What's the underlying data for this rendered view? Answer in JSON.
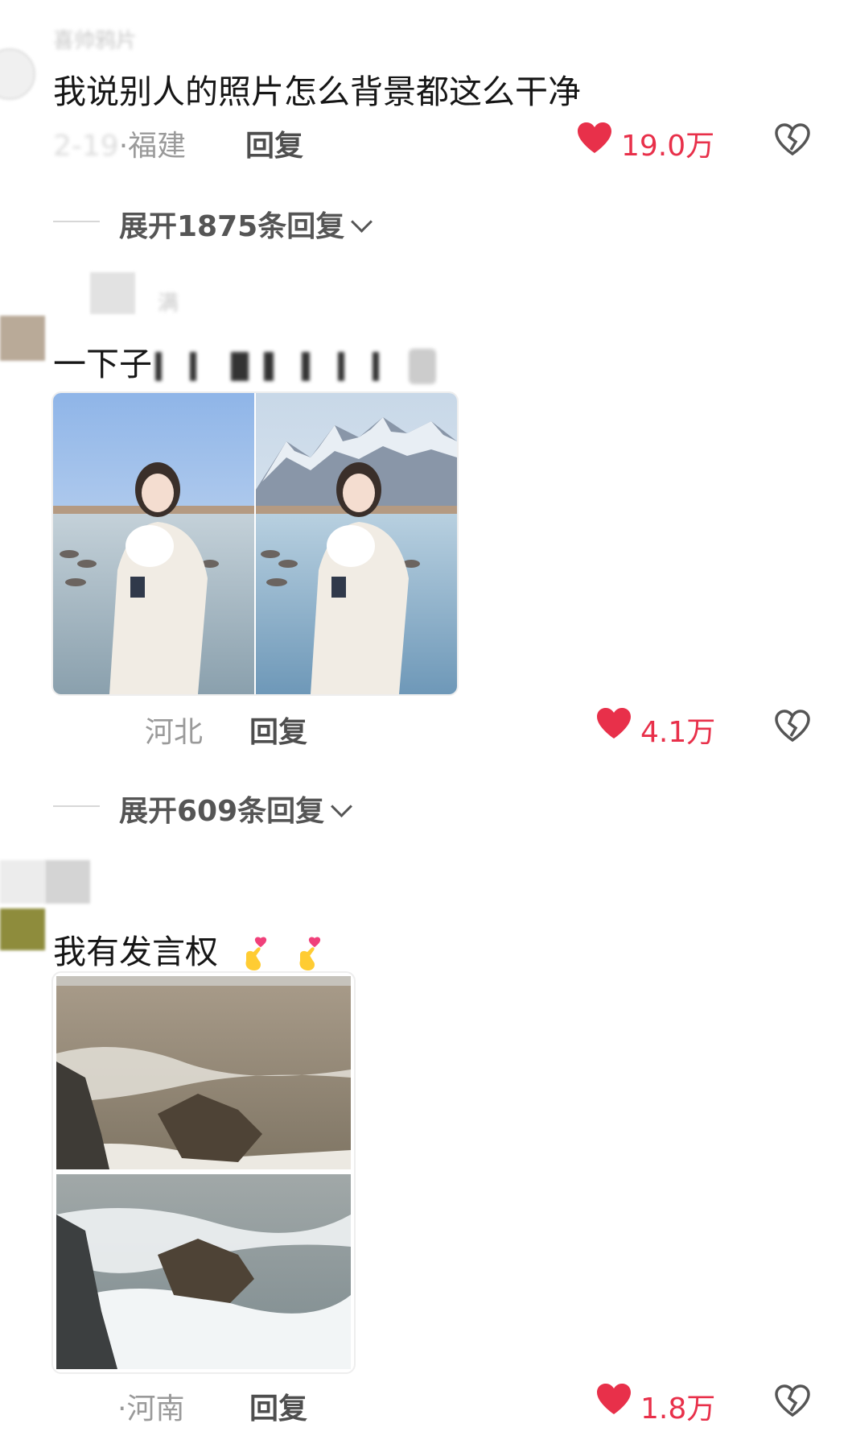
{
  "comments": [
    {
      "username": "喜帅鸦片",
      "text": "我说别人的照片怎么背景都这么干净",
      "location": "·福建",
      "date": "2-19",
      "reply_label": "回复",
      "likes": "19.0万",
      "expand_label": "展开1875条回复"
    },
    {
      "username": "满",
      "text": "一下子",
      "location": "河北",
      "reply_label": "回复",
      "likes": "4.1万",
      "expand_label": "展开609条回复"
    },
    {
      "text": "我有发言权",
      "location": "·河南",
      "reply_label": "回复",
      "likes": "1.8万"
    }
  ],
  "colors": {
    "like_red": "#e8304a",
    "text_gray": "#9a9a9a"
  },
  "icons": [
    "heart-icon",
    "broken-heart-icon",
    "chevron-down-icon",
    "finger-heart-emoji"
  ]
}
